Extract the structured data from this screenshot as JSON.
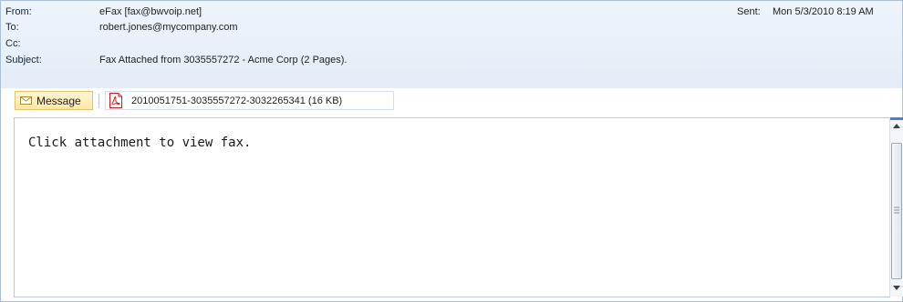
{
  "header": {
    "from_label": "From:",
    "from_value": "eFax [fax@bwvoip.net]",
    "to_label": "To:",
    "to_value": "robert.jones@mycompany.com",
    "cc_label": "Cc:",
    "cc_value": "",
    "subject_label": "Subject:",
    "subject_value": "Fax Attached from 3035557272 - Acme Corp (2 Pages).",
    "sent_label": "Sent:",
    "sent_value": "Mon 5/3/2010 8:19 AM"
  },
  "attachments": {
    "message_tab_label": "Message",
    "items": [
      {
        "name": "2010051751-3035557272-3032265341",
        "size": "(16 KB)",
        "icon": "pdf-icon"
      }
    ]
  },
  "body": {
    "text": "Click attachment to view fax."
  },
  "colors": {
    "header_bg": "#e3ecf7",
    "message_tab_bg": "#ffe7a2",
    "pdf_red": "#d21f1f",
    "border": "#a9bfd6"
  }
}
